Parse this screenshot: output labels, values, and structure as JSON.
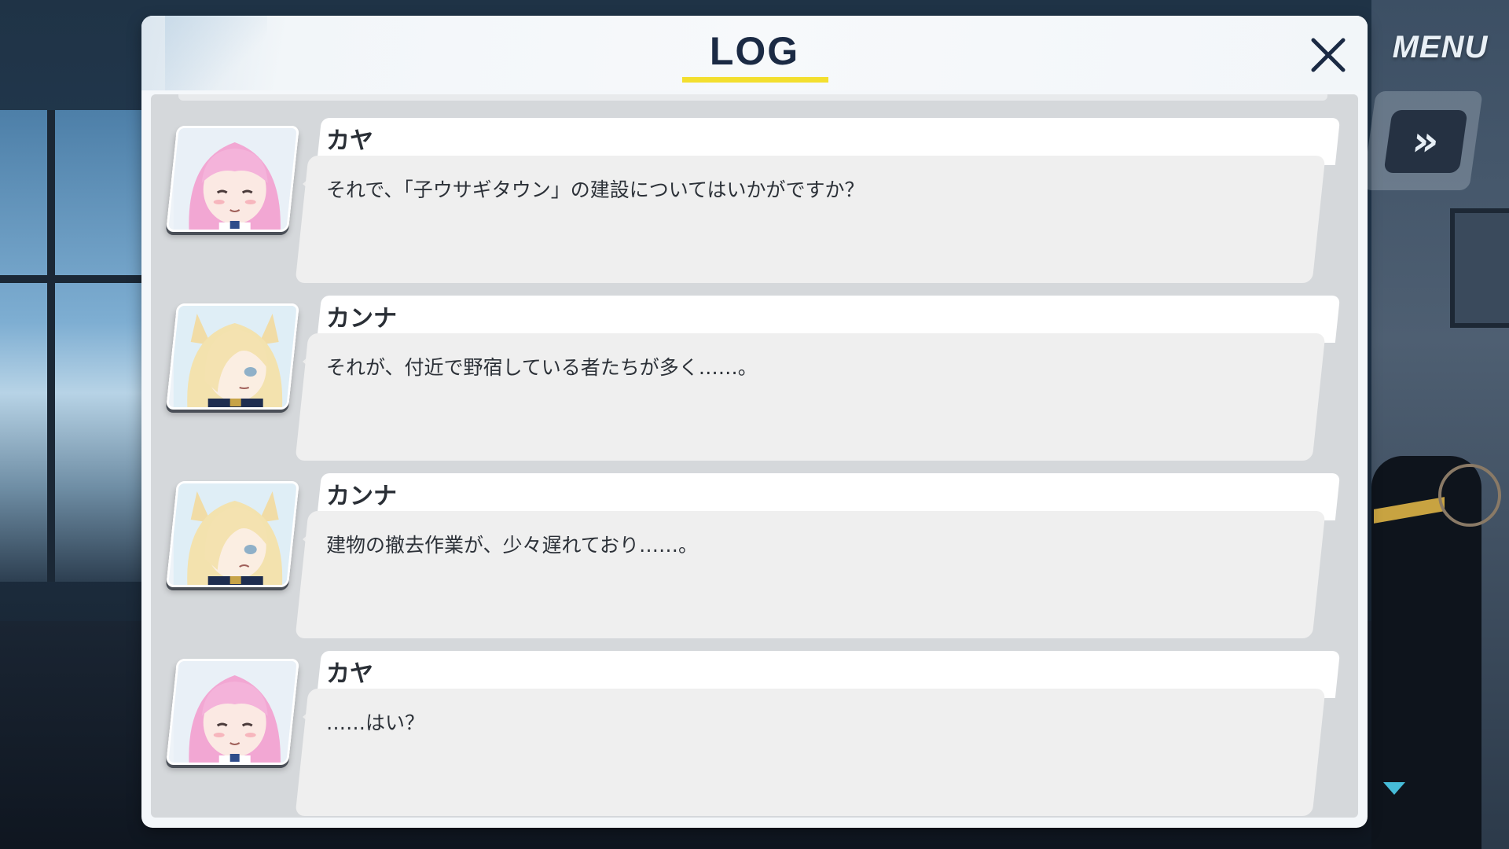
{
  "panel": {
    "title": "LOG"
  },
  "menu": {
    "label": "MENU",
    "fast_forward_label": "»"
  },
  "entries": [
    {
      "speaker": "カヤ",
      "text": "それで、「子ウサギタウン」の建設についてはいかがですか？",
      "portrait": "pink-hair-character"
    },
    {
      "speaker": "カンナ",
      "text": "それが、付近で野宿している者たちが多く……。",
      "portrait": "blonde-fox-ear-character"
    },
    {
      "speaker": "カンナ",
      "text": "建物の撤去作業が、少々遅れており……。",
      "portrait": "blonde-fox-ear-character"
    },
    {
      "speaker": "カヤ",
      "text": "……はい？",
      "portrait": "pink-hair-character"
    }
  ],
  "colors": {
    "title_underline": "#f3df2f",
    "title_text": "#1b2a44",
    "scroll_arrow": "#46bcd8"
  }
}
